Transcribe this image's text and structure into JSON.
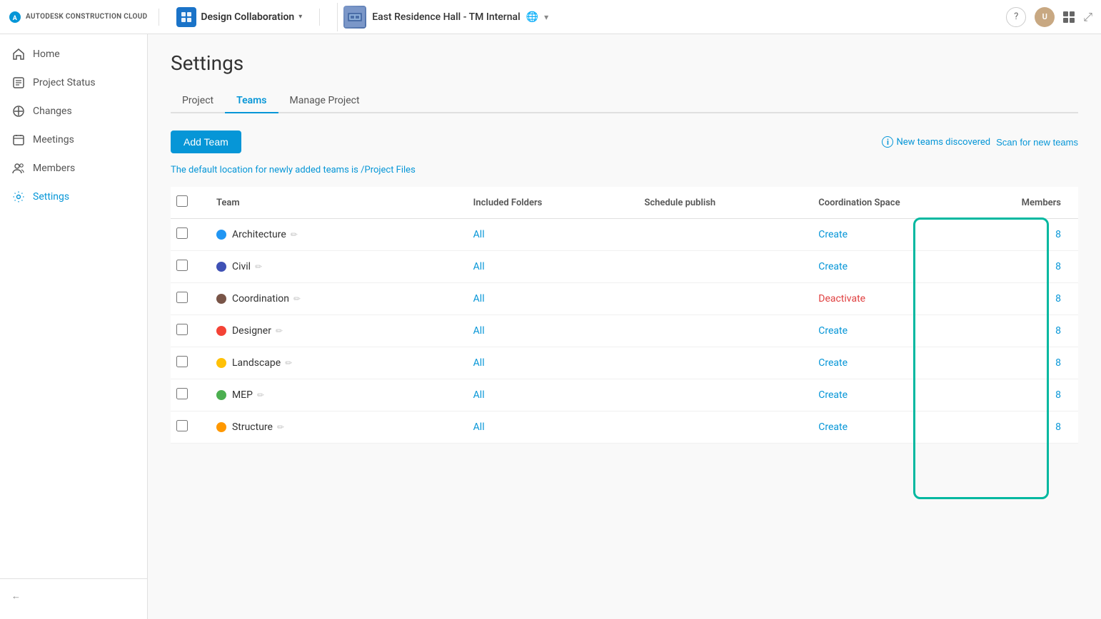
{
  "brand": {
    "logo_text": "AUTODESK CONSTRUCTION CLOUD"
  },
  "topbar": {
    "app_name": "Design Collaboration",
    "project_name": "East Residence Hall - TM Internal",
    "chevron": "▾",
    "help_label": "?",
    "expand_label": "⤢"
  },
  "sidebar": {
    "items": [
      {
        "id": "home",
        "label": "Home",
        "icon": "home-icon"
      },
      {
        "id": "project-status",
        "label": "Project Status",
        "icon": "project-status-icon"
      },
      {
        "id": "changes",
        "label": "Changes",
        "icon": "changes-icon"
      },
      {
        "id": "meetings",
        "label": "Meetings",
        "icon": "meetings-icon"
      },
      {
        "id": "members",
        "label": "Members",
        "icon": "members-icon"
      },
      {
        "id": "settings",
        "label": "Settings",
        "icon": "settings-icon"
      }
    ],
    "collapse_label": ""
  },
  "main": {
    "page_title": "Settings",
    "tabs": [
      {
        "id": "project",
        "label": "Project"
      },
      {
        "id": "teams",
        "label": "Teams"
      },
      {
        "id": "manage-project",
        "label": "Manage Project"
      }
    ],
    "active_tab": "teams",
    "add_team_label": "Add Team",
    "new_teams_text": "New teams discovered",
    "scan_label": "Scan for new teams",
    "default_location_text": "The default location for newly added teams is ",
    "default_location_path": "/Project Files",
    "table": {
      "columns": [
        {
          "id": "check",
          "label": ""
        },
        {
          "id": "team",
          "label": "Team"
        },
        {
          "id": "folders",
          "label": "Included Folders"
        },
        {
          "id": "schedule",
          "label": "Schedule publish"
        },
        {
          "id": "coord",
          "label": "Coordination Space"
        },
        {
          "id": "members",
          "label": "Members"
        }
      ],
      "rows": [
        {
          "id": 1,
          "color": "#2196F3",
          "name": "Architecture",
          "folders": "All",
          "schedule": "",
          "coord": "Create",
          "coord_action": "create",
          "members": "8"
        },
        {
          "id": 2,
          "color": "#3F51B5",
          "name": "Civil",
          "folders": "All",
          "schedule": "",
          "coord": "Create",
          "coord_action": "create",
          "members": "8"
        },
        {
          "id": 3,
          "color": "#795548",
          "name": "Coordination",
          "folders": "All",
          "schedule": "",
          "coord": "Deactivate",
          "coord_action": "deactivate",
          "members": "8"
        },
        {
          "id": 4,
          "color": "#F44336",
          "name": "Designer",
          "folders": "All",
          "schedule": "",
          "coord": "Create",
          "coord_action": "create",
          "members": "8"
        },
        {
          "id": 5,
          "color": "#FFC107",
          "name": "Landscape",
          "folders": "All",
          "schedule": "",
          "coord": "Create",
          "coord_action": "create",
          "members": "8"
        },
        {
          "id": 6,
          "color": "#4CAF50",
          "name": "MEP",
          "folders": "All",
          "schedule": "",
          "coord": "Create",
          "coord_action": "create",
          "members": "8"
        },
        {
          "id": 7,
          "color": "#FF9800",
          "name": "Structure",
          "folders": "All",
          "schedule": "",
          "coord": "Create",
          "coord_action": "create",
          "members": "8"
        }
      ]
    }
  }
}
